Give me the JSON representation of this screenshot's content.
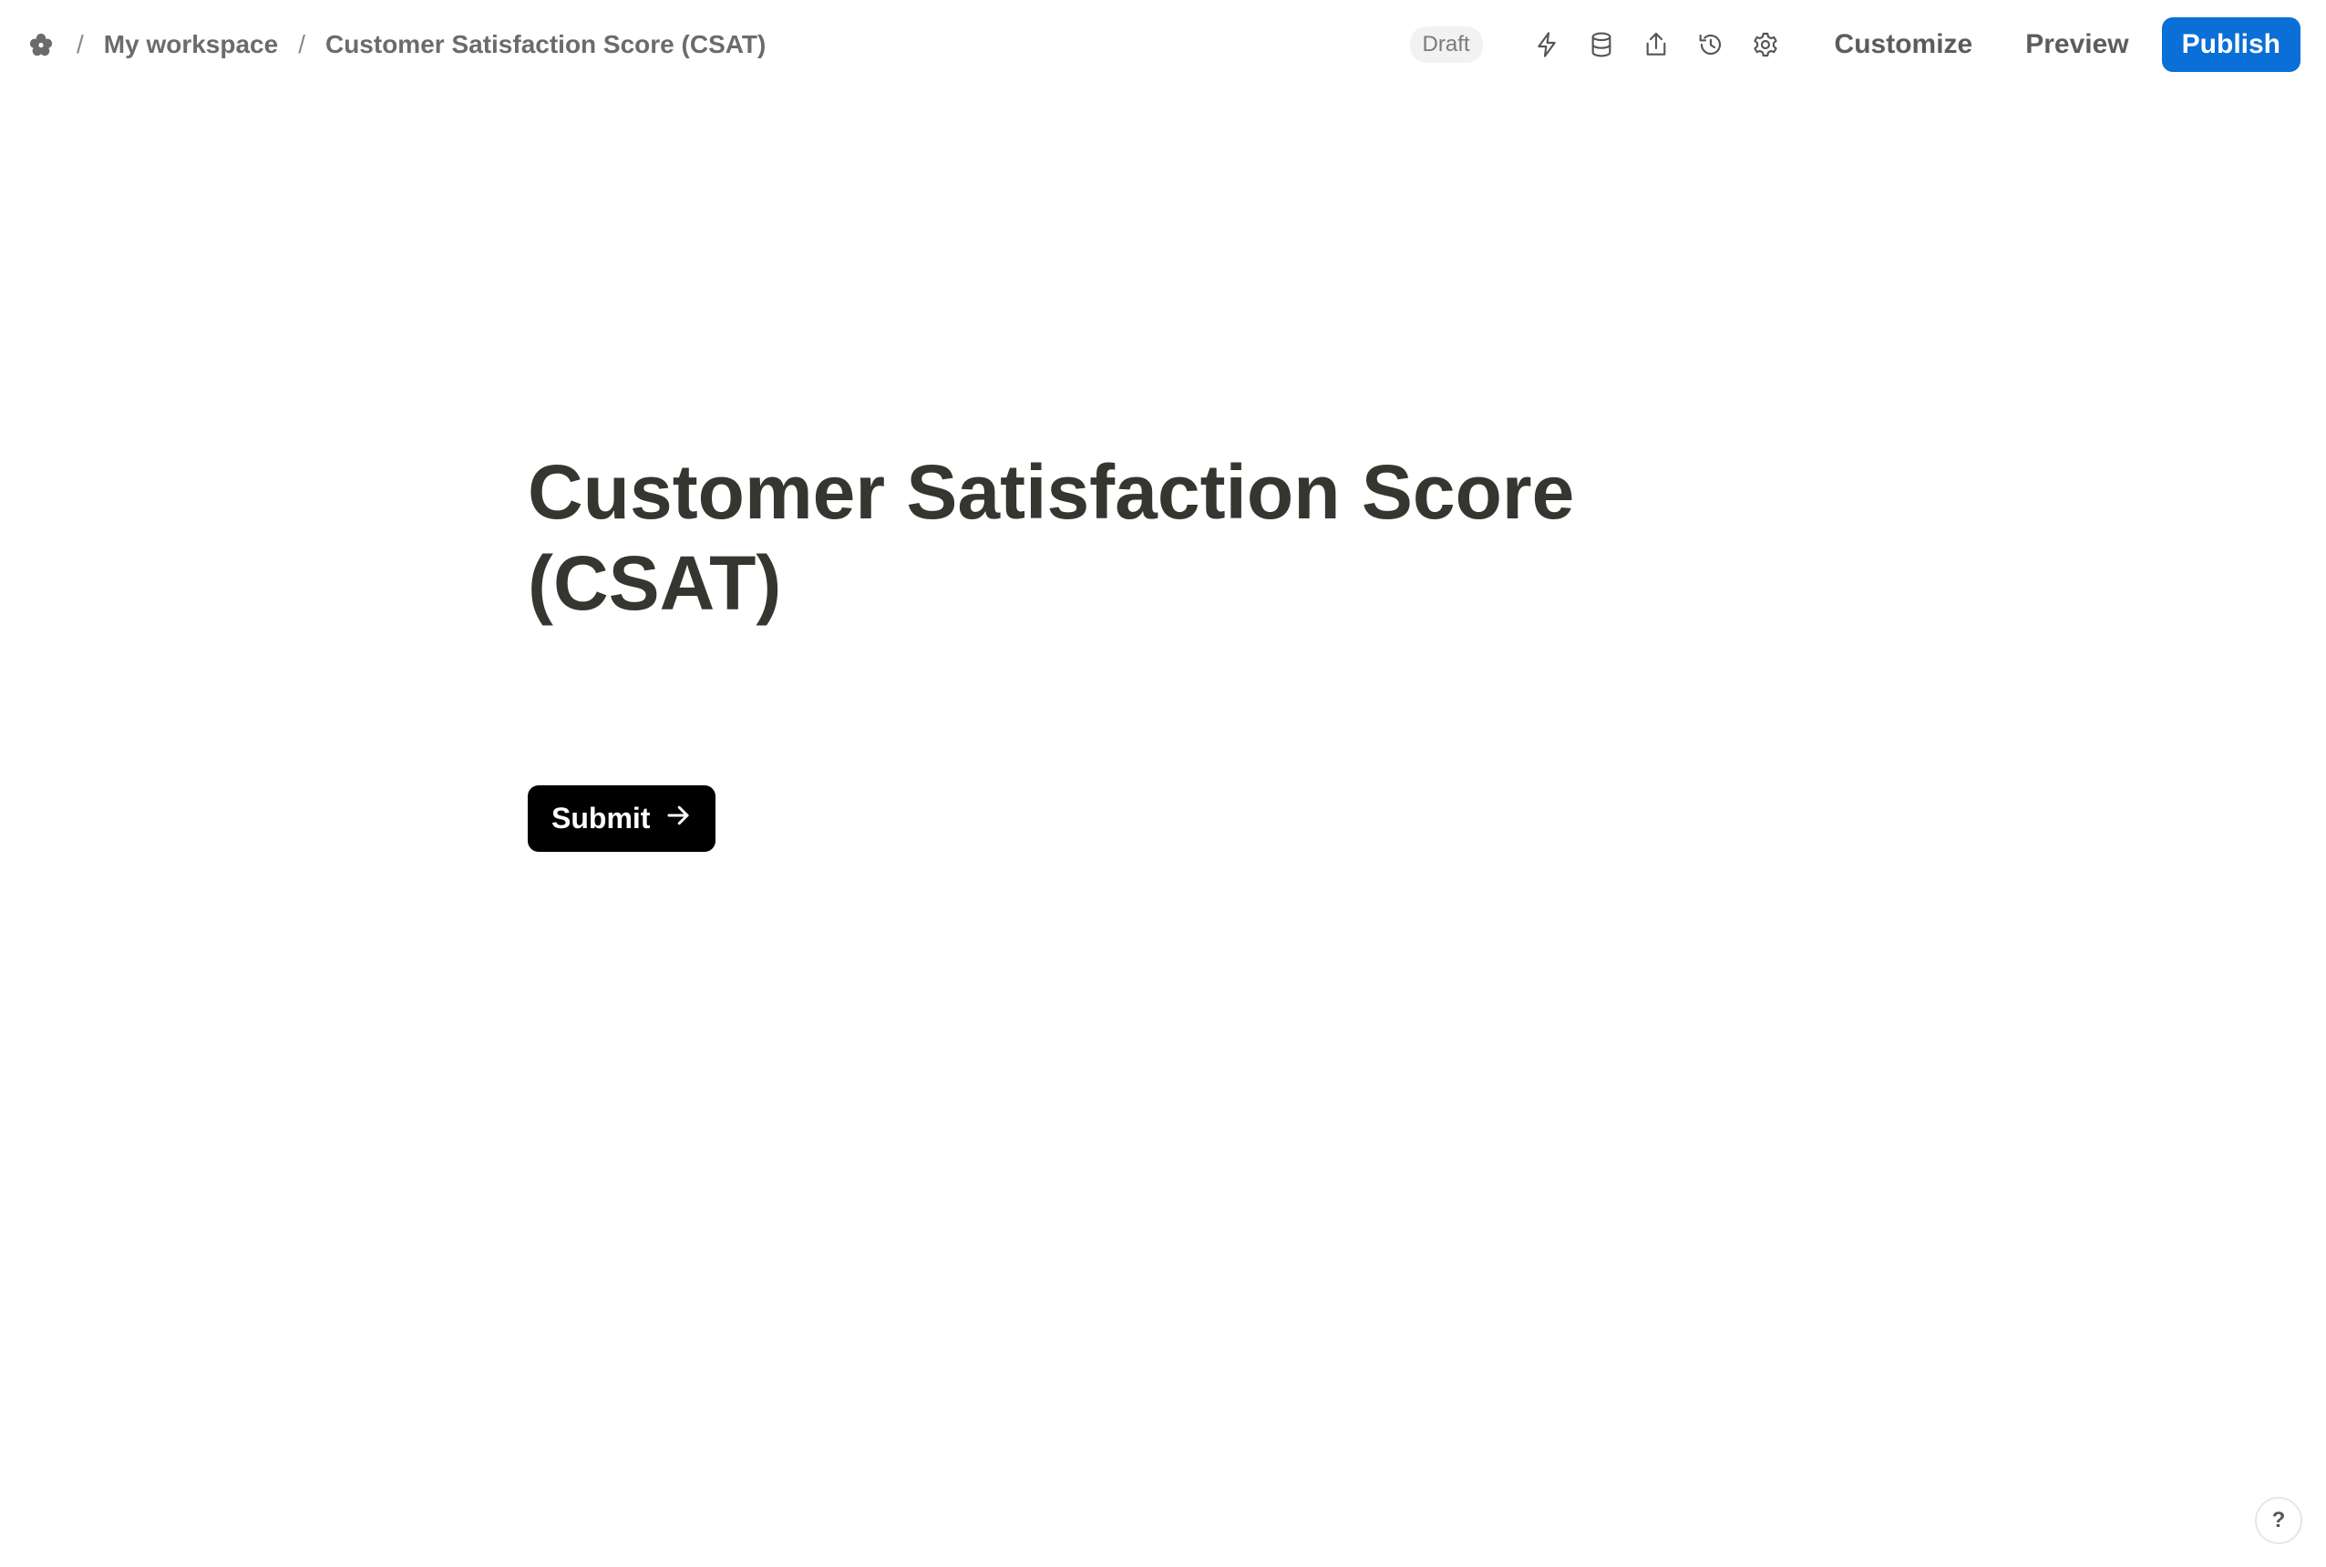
{
  "breadcrumb": {
    "logo_icon": "flower-logo-icon",
    "separator": "/",
    "workspace": "My workspace",
    "form": "Customer Satisfaction Score (CSAT)"
  },
  "toolbar": {
    "status_badge": "Draft",
    "icons": [
      "lightning-icon",
      "database-icon",
      "share-icon",
      "history-icon",
      "gear-icon"
    ],
    "customize_label": "Customize",
    "preview_label": "Preview",
    "publish_label": "Publish",
    "accent_color": "#0a6fd6"
  },
  "form": {
    "title": "Customer Satisfaction Score (CSAT)",
    "submit_label": "Submit",
    "submit_icon": "arrow-right-icon"
  },
  "help": {
    "label": "?"
  }
}
